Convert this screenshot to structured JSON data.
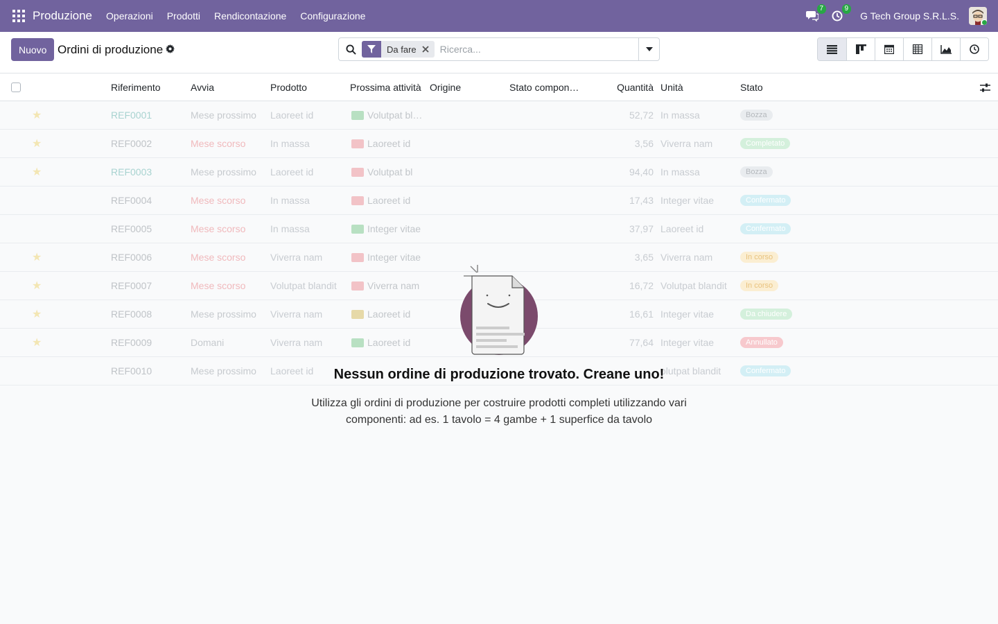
{
  "navbar": {
    "brand": "Produzione",
    "menu": [
      "Operazioni",
      "Prodotti",
      "Rendicontazione",
      "Configurazione"
    ],
    "messages_count": "7",
    "activities_count": "9",
    "company": "G Tech Group S.R.L.S.",
    "accent": "#71639e"
  },
  "control": {
    "new_label": "Nuovo",
    "title": "Ordini di produzione",
    "search": {
      "facet_label": "Da fare",
      "placeholder": "Ricerca..."
    },
    "views": [
      "list-icon",
      "kanban-icon",
      "calendar-icon",
      "pivot-icon",
      "graph-icon",
      "activity-icon"
    ]
  },
  "list": {
    "columns": [
      "Riferimento",
      "Avvia",
      "Prodotto",
      "Prossima attività",
      "Origine",
      "Stato compon…",
      "Quantità",
      "Unità",
      "Stato"
    ],
    "rows": [
      {
        "starred": true,
        "ref": "REF0001",
        "start": "Mese prossimo",
        "product": "Laoreet id",
        "activity": "Volutpat bl…",
        "qty": "52,72",
        "unit": "In massa",
        "state": "Bozza",
        "state_color": "#e9ecef",
        "state_text": "#b5b9bd"
      },
      {
        "starred": true,
        "ref": "REF0002",
        "start": "Mese scorso",
        "product": "In massa",
        "activity": "Laoreet id",
        "qty": "3,56",
        "unit": "Viverra nam",
        "state": "Completato",
        "state_color": "#d4f0dc",
        "state_text": "#ffffff"
      },
      {
        "starred": true,
        "ref": "REF0003",
        "start": "Mese prossimo",
        "product": "Laoreet id",
        "activity": "Volutpat bl",
        "qty": "94,40",
        "unit": "In massa",
        "state": "Bozza",
        "state_color": "#e9ecef",
        "state_text": "#b5b9bd"
      },
      {
        "starred": false,
        "ref": "REF0004",
        "start": "Mese scorso",
        "product": "In massa",
        "activity": "Laoreet id",
        "qty": "17,43",
        "unit": "Integer vitae",
        "state": "Confermato",
        "state_color": "#d3eff5",
        "state_text": "#ffffff"
      },
      {
        "starred": false,
        "ref": "REF0005",
        "start": "Mese scorso",
        "product": "In massa",
        "activity": "Integer vitae",
        "qty": "37,97",
        "unit": "Laoreet id",
        "state": "Confermato",
        "state_color": "#d3eff5",
        "state_text": "#ffffff"
      },
      {
        "starred": true,
        "ref": "REF0006",
        "start": "Mese scorso",
        "product": "Viverra nam",
        "activity": "Integer vitae",
        "qty": "3,65",
        "unit": "Viverra nam",
        "state": "In corso",
        "state_color": "#fbeed2",
        "state_text": "#e8c27d"
      },
      {
        "starred": true,
        "ref": "REF0007",
        "start": "Mese scorso",
        "product": "Volutpat blandit",
        "activity": "Viverra nam",
        "qty": "16,72",
        "unit": "Volutpat blandit",
        "state": "In corso",
        "state_color": "#fbeed2",
        "state_text": "#e8c27d"
      },
      {
        "starred": true,
        "ref": "REF0008",
        "start": "Mese prossimo",
        "product": "Viverra nam",
        "activity": "Laoreet id",
        "qty": "16,61",
        "unit": "Integer vitae",
        "state": "Da chiudere",
        "state_color": "#d4f0dc",
        "state_text": "#ffffff"
      },
      {
        "starred": true,
        "ref": "REF0009",
        "start": "Domani",
        "product": "Viverra nam",
        "activity": "Laoreet id",
        "qty": "77,64",
        "unit": "Integer vitae",
        "state": "Annullato",
        "state_color": "#f7c9cd",
        "state_text": "#ffffff"
      },
      {
        "starred": false,
        "ref": "REF0010",
        "start": "Mese prossimo",
        "product": "Laoreet id",
        "activity": "",
        "qty": "",
        "unit": "olutpat blandit",
        "state": "Confermato",
        "state_color": "#d3eff5",
        "state_text": "#ffffff"
      }
    ]
  },
  "empty": {
    "title": "Nessun ordine di produzione trovato. Creane uno!",
    "text": "Utilizza gli ordini di produzione per costruire prodotti completi utilizzando vari componenti: ad es. 1 tavolo = 4 gambe + 1 superfice da tavolo"
  }
}
